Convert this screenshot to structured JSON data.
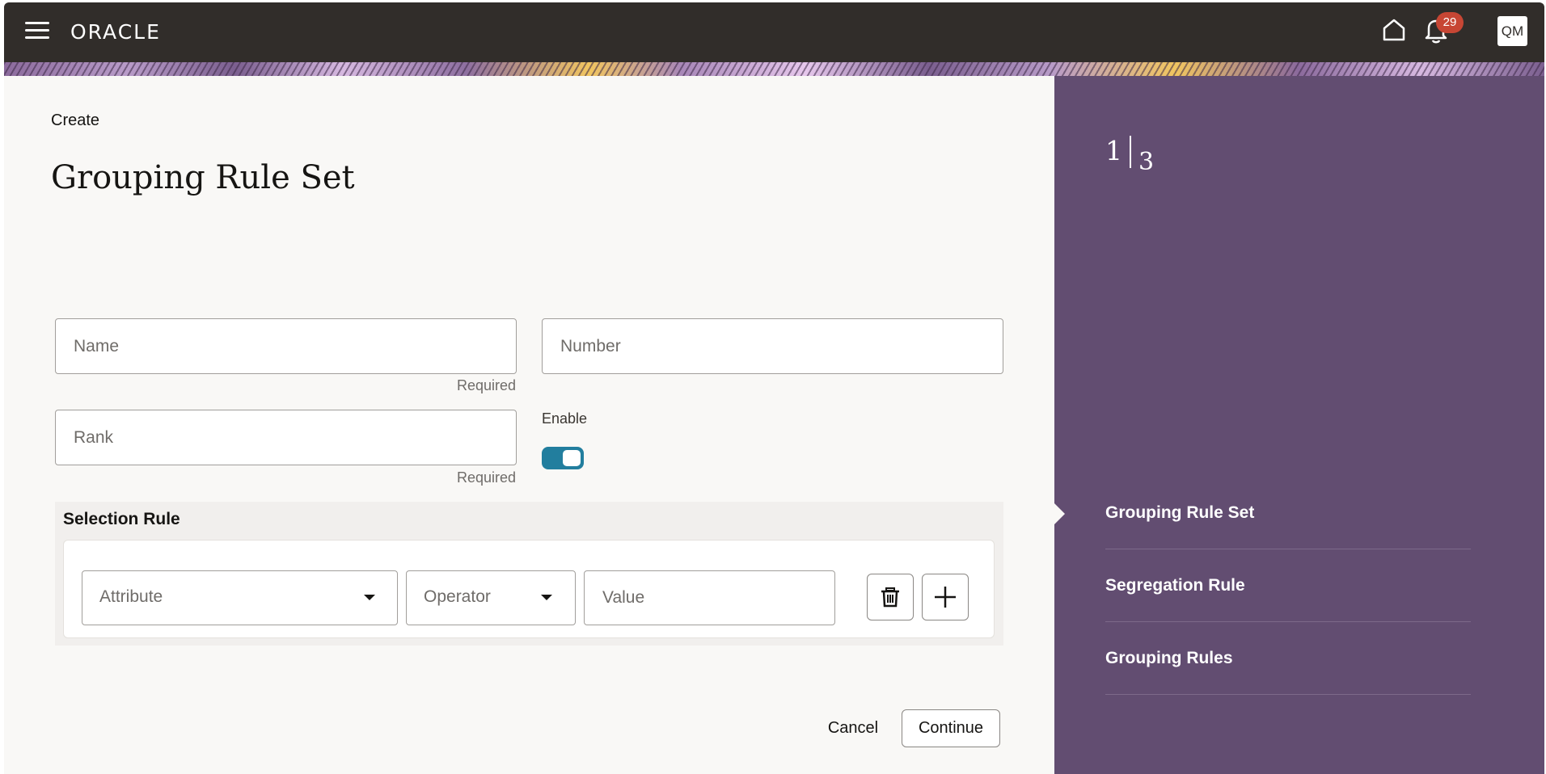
{
  "header": {
    "logo": "ORACLE",
    "notification_count": "29",
    "user_initials": "QM",
    "icons": [
      "menu-icon",
      "home-icon",
      "bell-icon"
    ]
  },
  "page": {
    "breadcrumb": "Create",
    "title": "Grouping Rule Set"
  },
  "form": {
    "name": {
      "placeholder": "Name",
      "hint": "Required"
    },
    "number": {
      "placeholder": "Number"
    },
    "rank": {
      "placeholder": "Rank",
      "hint": "Required"
    },
    "enable": {
      "label": "Enable",
      "value": true
    }
  },
  "selection_rule": {
    "title": "Selection Rule",
    "attribute_placeholder": "Attribute",
    "operator_placeholder": "Operator",
    "value_placeholder": "Value",
    "icons": [
      "trash-icon",
      "plus-icon"
    ]
  },
  "actions": {
    "cancel": "Cancel",
    "continue": "Continue"
  },
  "train": {
    "current": "1",
    "total": "3",
    "steps": [
      {
        "label": "Grouping Rule Set",
        "active": true
      },
      {
        "label": "Segregation Rule",
        "active": false
      },
      {
        "label": "Grouping Rules",
        "active": false
      }
    ]
  },
  "colors": {
    "header_bg": "#312d2a",
    "panel_bg": "#624d71",
    "toggle_on": "#227e9e",
    "badge": "#c74634"
  }
}
